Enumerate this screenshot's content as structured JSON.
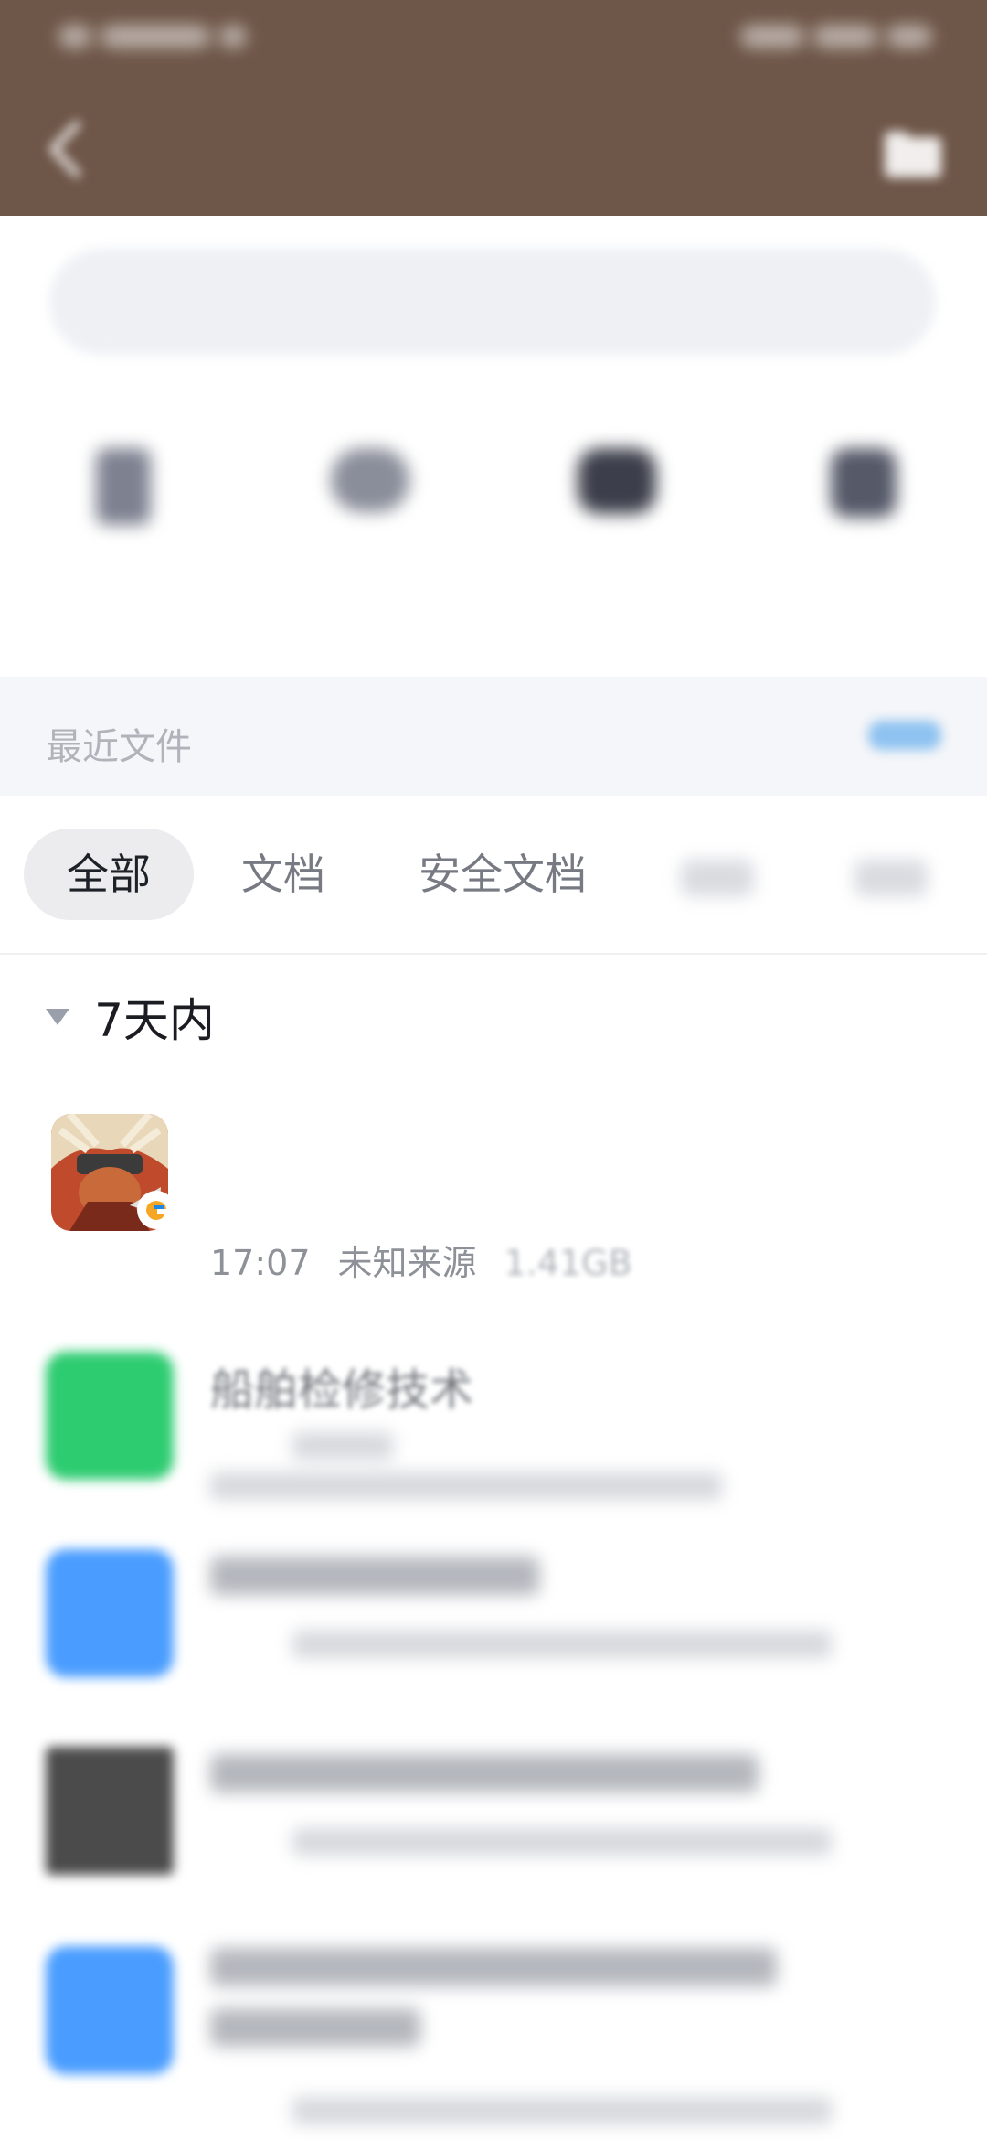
{
  "header": {
    "title": "",
    "status_left": "",
    "status_right": ""
  },
  "search": {
    "placeholder": ""
  },
  "categories": [
    {
      "label": ""
    },
    {
      "label": ""
    },
    {
      "label": ""
    },
    {
      "label": ""
    }
  ],
  "section": {
    "title": "最近文件",
    "more": ""
  },
  "tabs": [
    {
      "label": "全部",
      "active": true
    },
    {
      "label": "文档"
    },
    {
      "label": "安全文档"
    },
    {
      "label": ""
    },
    {
      "label": ""
    }
  ],
  "group": {
    "label": "7天内",
    "icon": "triangle-down-icon"
  },
  "files": [
    {
      "name": "",
      "time": "17:07",
      "source": "未知来源",
      "size": "1.41GB",
      "icon": "game-app-icon"
    },
    {
      "name": "船舶检修技术",
      "time": "",
      "source": "",
      "size": "",
      "icon": "green-doc-icon"
    },
    {
      "name": "",
      "time": "",
      "source": "",
      "size": "",
      "icon": "word-doc-icon"
    },
    {
      "name": "",
      "time": "",
      "source": "",
      "size": "",
      "icon": "image-thumbnail-icon"
    },
    {
      "name": "",
      "time": "",
      "source": "",
      "size": "",
      "icon": "word-doc-icon"
    }
  ],
  "colors": {
    "header": "#6e5648",
    "accent": "#4a9dff",
    "green": "#2ecc71",
    "tab_active_bg": "#ececee"
  }
}
